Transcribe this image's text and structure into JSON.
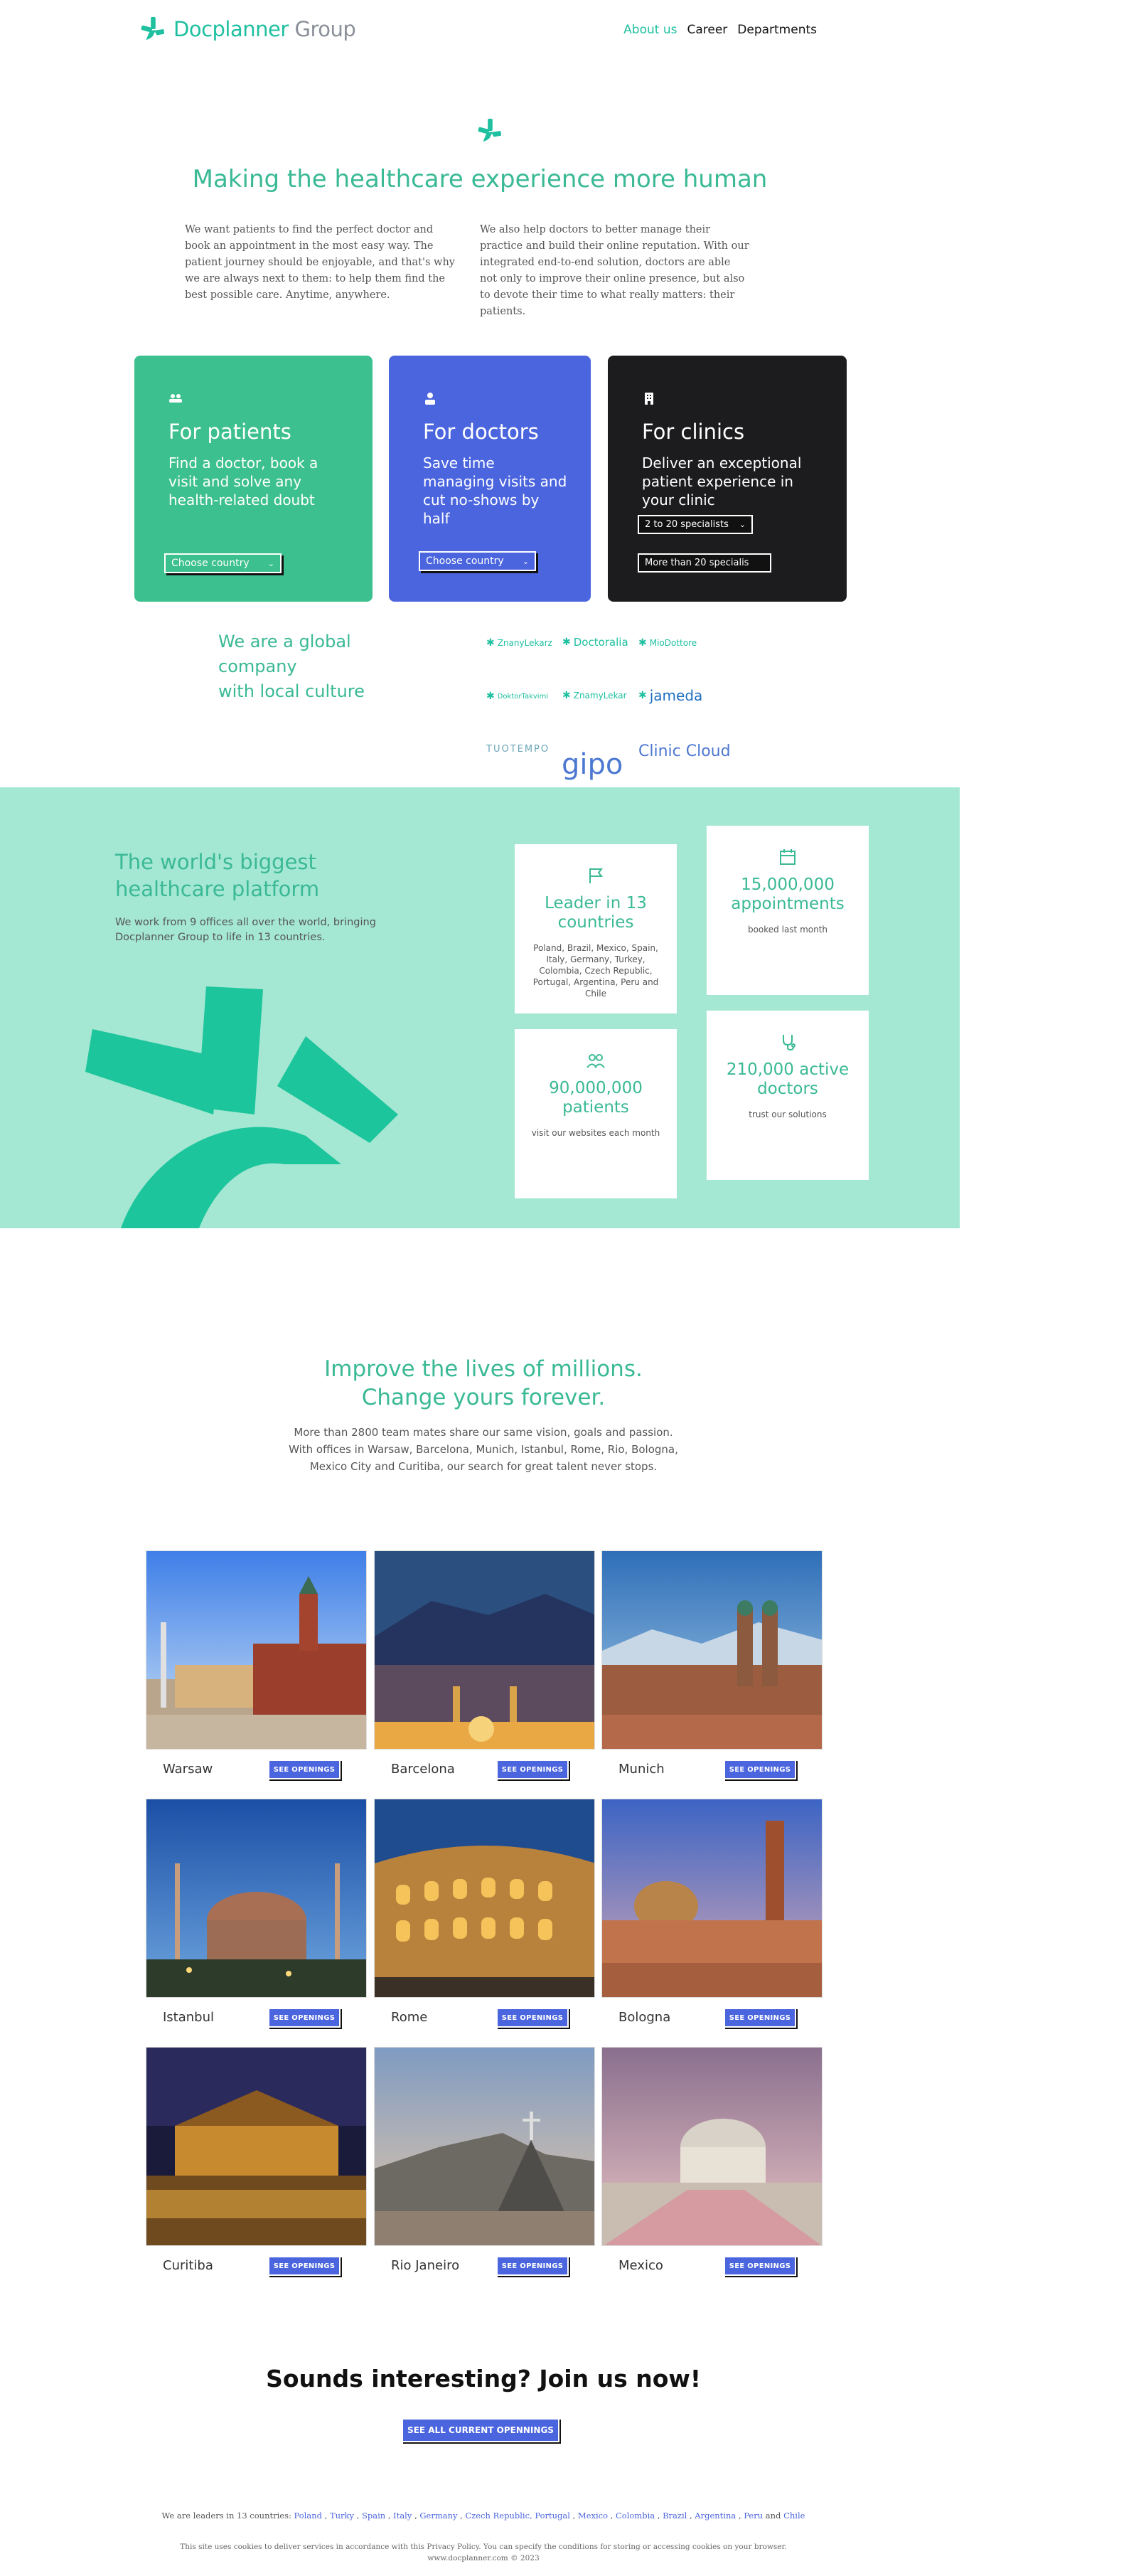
{
  "header": {
    "brand_primary": "Docplanner",
    "brand_secondary": "Group",
    "nav": [
      {
        "label": "About us",
        "active": true
      },
      {
        "label": "Career",
        "active": false
      },
      {
        "label": "Departments",
        "active": false
      }
    ]
  },
  "hero": {
    "title": "Making the healthcare experience more human",
    "left_text": "We want patients to find the perfect doctor and book an appointment in the most easy way. The patient journey should be enjoyable, and that's why we are always next to them: to help them find the best possible care. Anytime, anywhere.",
    "right_text": "We also help doctors to better manage their practice and build their online reputation. With our integrated end-to-end solution, doctors are able not only to improve their online presence, but also to devote their time to what really matters: their patients."
  },
  "cards": [
    {
      "title": "For patients",
      "desc": "Find a doctor, book a visit and solve any health-related doubt",
      "select": "Choose country",
      "icon": "people-icon"
    },
    {
      "title": "For doctors",
      "desc": "Save time managing visits and cut no-shows by half",
      "select": "Choose country",
      "icon": "doctor-icon"
    },
    {
      "title": "For clinics",
      "desc": "Deliver an exceptional patient experience in your clinic",
      "select_1": "2 to 20 specialists",
      "select_2": "More than 20 specialis",
      "icon": "building-icon"
    }
  ],
  "global": {
    "text": [
      "We are a global",
      "company",
      "with local culture"
    ],
    "partners": [
      "ZnanyLekarz",
      "Doctoralia",
      "MioDottore",
      "DoktorTakvimi",
      "ZnamyLekar",
      "jameda",
      "TUOTEMPO",
      "gipo",
      "Clinic Cloud"
    ]
  },
  "platform": {
    "title_line1": "The world's biggest",
    "title_line2": "healthcare platform",
    "text": "We work from 9 offices all over the world, bringing Docplanner Group to life in 13 countries.",
    "stats": [
      {
        "value": "Leader in 13 countries",
        "desc": "Poland, Brazil, Mexico, Spain, Italy, Germany, Turkey, Colombia, Czech Republic, Portugal, Argentina, Peru and Chile",
        "icon": "flag-icon"
      },
      {
        "value": "15,000,000 appointments",
        "desc": "booked last month",
        "icon": "calendar-icon"
      },
      {
        "value": "90,000,000 patients",
        "desc": "visit our websites each month",
        "icon": "group-icon"
      },
      {
        "value": "210,000 active doctors",
        "desc": "trust our solutions",
        "icon": "stethoscope-icon"
      }
    ]
  },
  "lives": {
    "title_line1": "Improve the lives of millions.",
    "title_line2": "Change yours forever.",
    "text_line1": "More than 2800 team mates share our same vision, goals and passion.",
    "text_line2": "With offices in Warsaw, Barcelona, Munich, Istanbul, Rome, Rio, Bologna,",
    "text_line3": "Mexico City and Curitiba, our search for great talent never stops."
  },
  "cities": [
    {
      "name": "Warsaw",
      "button": "SEE OPENINGS"
    },
    {
      "name": "Barcelona",
      "button": "SEE OPENINGS"
    },
    {
      "name": "Munich",
      "button": "SEE OPENINGS"
    },
    {
      "name": "Istanbul",
      "button": "SEE OPENINGS"
    },
    {
      "name": "Rome",
      "button": "SEE OPENINGS"
    },
    {
      "name": "Bologna",
      "button": "SEE OPENINGS"
    },
    {
      "name": "Curitiba",
      "button": "SEE OPENINGS"
    },
    {
      "name": "Rio Janeiro",
      "button": "SEE OPENINGS"
    },
    {
      "name": "Mexico",
      "button": "SEE OPENINGS"
    }
  ],
  "join": {
    "title": "Sounds interesting? Join us now!",
    "button": "SEE ALL CURRENT OPENNINGS"
  },
  "footer": {
    "countries_prefix": "We are leaders in 13 countries:",
    "countries": [
      "Poland",
      "Turky",
      "Spain",
      "Italy",
      "Germany",
      "Czech Republic, Portugal",
      "Mexico",
      "Colombia",
      "Brazil",
      "Argentina",
      "Peru",
      "Chile"
    ],
    "cookies": "This site uses cookies to deliver services in accordance with this Privacy Policy. You can specify the conditions for storing or accessing cookies on your browser.",
    "copyright": "www.docplanner.com © 2023"
  },
  "colors": {
    "brand_green": "#3ab995",
    "patients": "#3dc08f",
    "doctors": "#4b65de",
    "clinics": "#1c1b1d",
    "band": "#a4e7d3"
  }
}
